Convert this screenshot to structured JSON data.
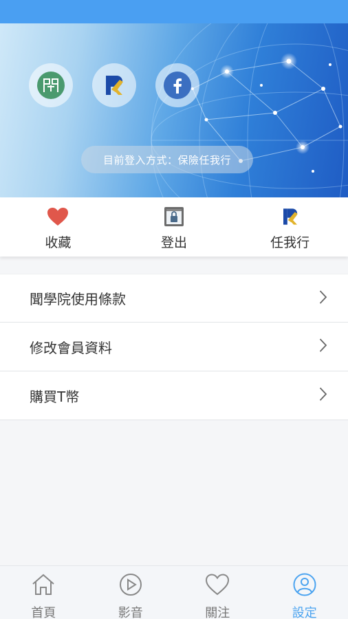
{
  "login": {
    "method_text": "目前登入方式：保險任我行",
    "icons": [
      "wenxueyuan-logo-icon",
      "renwoxing-logo-icon",
      "facebook-icon"
    ]
  },
  "quick_actions": [
    {
      "label": "收藏",
      "icon": "heart-icon"
    },
    {
      "label": "登出",
      "icon": "logout-icon"
    },
    {
      "label": "任我行",
      "icon": "renwoxing-logo-icon"
    }
  ],
  "menu": [
    {
      "label": "聞學院使用條款"
    },
    {
      "label": "修改會員資料"
    },
    {
      "label": "購買T幣"
    }
  ],
  "tabs": [
    {
      "label": "首頁",
      "icon": "home-icon"
    },
    {
      "label": "影音",
      "icon": "play-icon"
    },
    {
      "label": "關注",
      "icon": "heart-outline-icon"
    },
    {
      "label": "設定",
      "icon": "user-icon",
      "active": true
    }
  ],
  "colors": {
    "accent": "#4aa3f0",
    "status_bar": "#4a9ff2",
    "heart": "#e0574b",
    "wenxueyuan_green": "#4a9a6e",
    "facebook_blue": "#3b6fc1"
  }
}
